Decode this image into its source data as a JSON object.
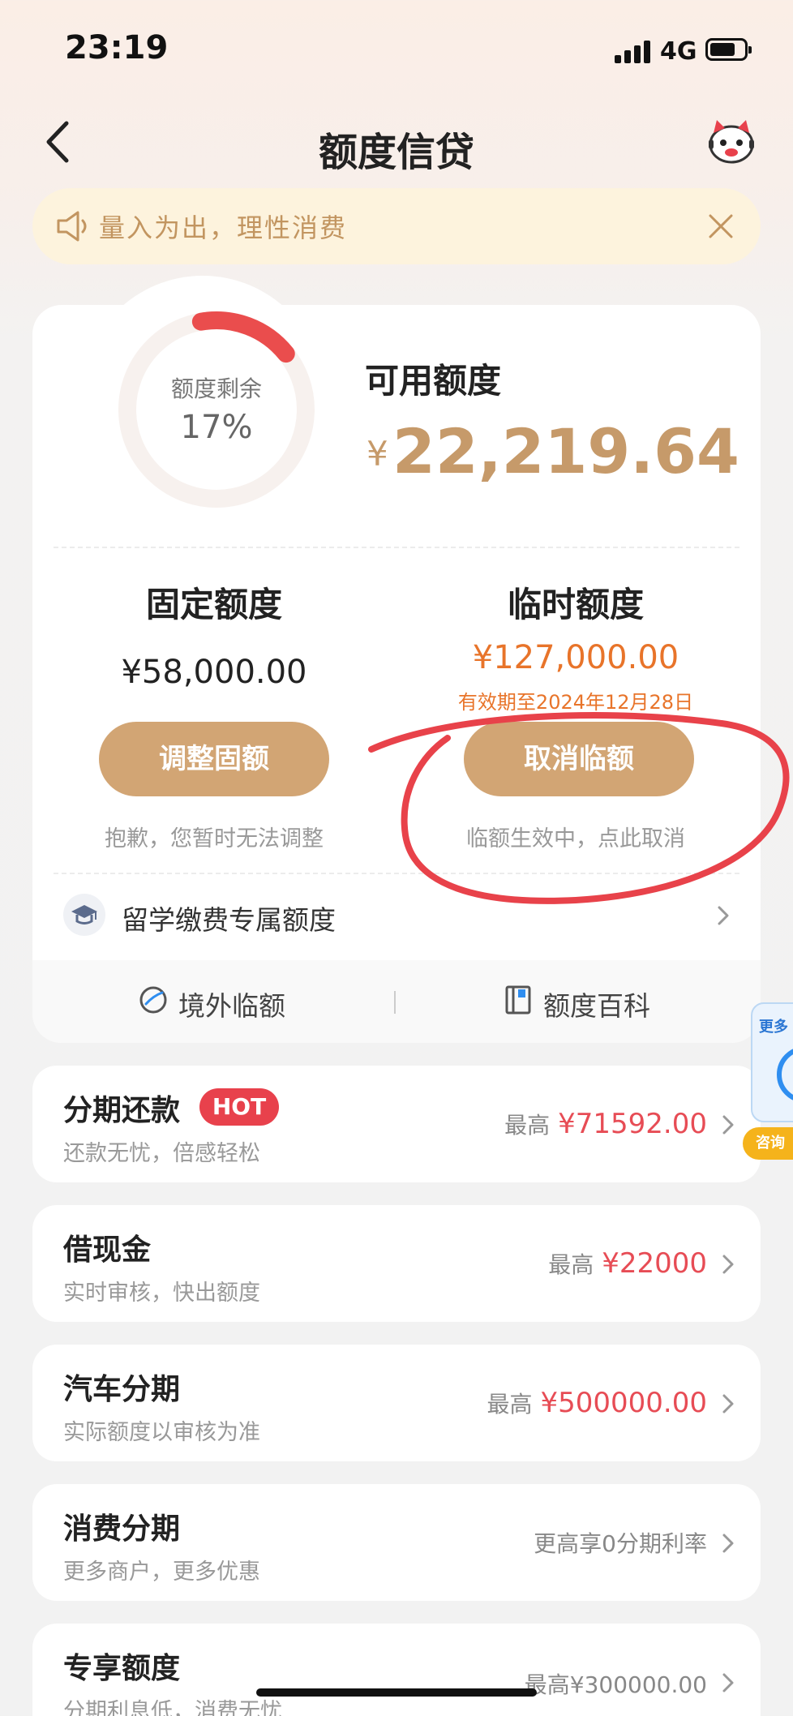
{
  "status_bar": {
    "time": "23:19",
    "network": "4G"
  },
  "nav": {
    "title": "额度信贷"
  },
  "notice": {
    "text": "量入为出，理性消费"
  },
  "credit": {
    "ring_label": "额度剩余",
    "ring_percent_text": "17%",
    "remaining_fraction": 0.17,
    "available_label": "可用额度",
    "currency_symbol": "¥",
    "available_amount": "22,219.64",
    "fixed": {
      "title": "固定额度",
      "amount": "¥58,000.00",
      "button": "调整固额",
      "note": "抱歉，您暂时无法调整"
    },
    "temporary": {
      "title": "临时额度",
      "amount": "¥127,000.00",
      "validity": "有效期至2024年12月28日",
      "button": "取消临额",
      "note": "临额生效中，点此取消"
    },
    "study_abroad": "留学缴费专属额度",
    "links": {
      "left": "境外临额",
      "right": "额度百科"
    }
  },
  "products": [
    {
      "title": "分期还款",
      "badge": "HOT",
      "subtitle": "还款无忧，倍感轻松",
      "prefix": "最高",
      "amount": "¥71592.00"
    },
    {
      "title": "借现金",
      "subtitle": "实时审核，快出额度",
      "prefix": "最高",
      "amount": "¥22000"
    },
    {
      "title": "汽车分期",
      "subtitle": "实际额度以审核为准",
      "prefix": "最高",
      "amount": "¥500000.00"
    },
    {
      "title": "消费分期",
      "subtitle": "更多商户，更多优惠",
      "prefix": "更高享0分期利率",
      "amount": ""
    },
    {
      "title": "专享额度",
      "subtitle": "分期利息低，消费无忧",
      "prefix": "最高¥300000.00",
      "amount": ""
    }
  ],
  "float_widget": {
    "top_text": "更多",
    "bottom_text": "咨询"
  },
  "colors": {
    "gold": "#c69a6a",
    "button": "#d2a574",
    "red": "#e74c55",
    "orange": "#e8742a",
    "annotation": "#e8424a"
  }
}
